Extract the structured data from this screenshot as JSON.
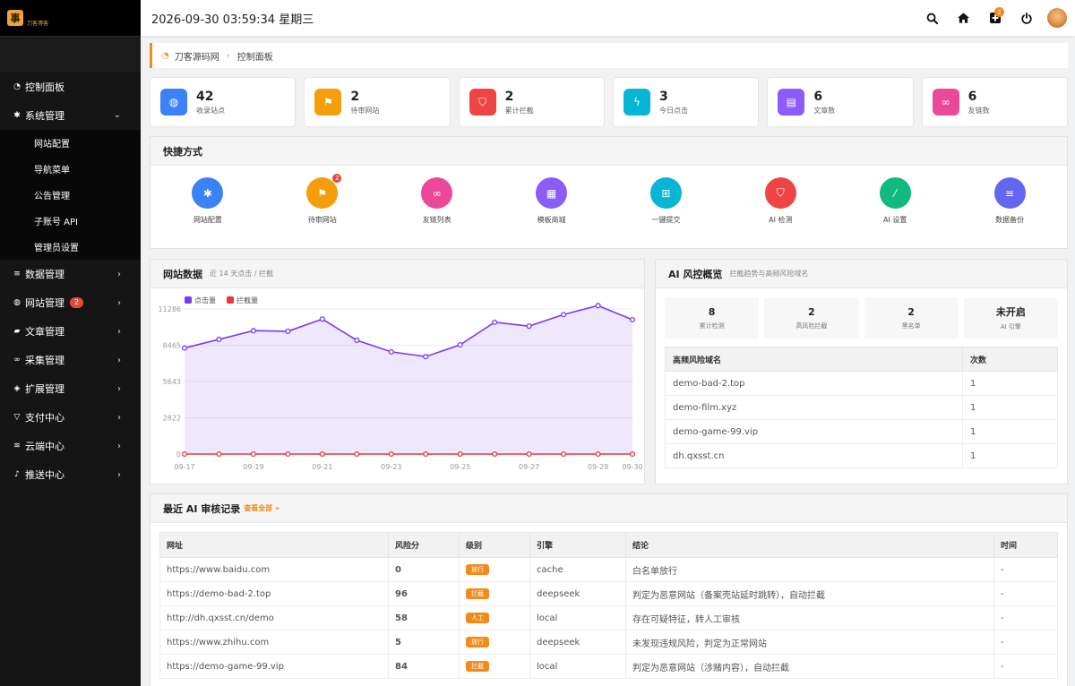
{
  "app": {
    "logo_char": "事",
    "logo_text": "刀客博客"
  },
  "topbar": {
    "datetime": "2026-09-30 03:59:34 星期三",
    "notification_count": "2"
  },
  "sidebar": {
    "items": [
      {
        "label": "控制面板",
        "icon": "dashboard-icon"
      },
      {
        "label": "系统管理",
        "icon": "gear-icon",
        "expanded": true,
        "children": [
          "网站配置",
          "导航菜单",
          "公告管理",
          "子账号 API",
          "管理员设置"
        ]
      },
      {
        "label": "数据管理",
        "icon": "database-icon"
      },
      {
        "label": "网站管理",
        "icon": "globe-icon",
        "badge": "2"
      },
      {
        "label": "文章管理",
        "icon": "book-icon"
      },
      {
        "label": "采集管理",
        "icon": "link-icon"
      },
      {
        "label": "扩展管理",
        "icon": "cube-icon"
      },
      {
        "label": "支付中心",
        "icon": "cart-icon"
      },
      {
        "label": "云端中心",
        "icon": "wifi-icon"
      },
      {
        "label": "推送中心",
        "icon": "bell-icon"
      }
    ]
  },
  "breadcrumb": {
    "site": "刀客源码网",
    "current": "控制面板"
  },
  "stats": [
    {
      "value": "42",
      "label": "收录站点",
      "color": "#3b82f6",
      "icon": "globe-icon"
    },
    {
      "value": "2",
      "label": "待审网站",
      "color": "#f59e0b",
      "icon": "flag-icon"
    },
    {
      "value": "2",
      "label": "累计拦截",
      "color": "#ef4444",
      "icon": "shield-icon"
    },
    {
      "value": "3",
      "label": "今日点击",
      "color": "#06b6d4",
      "icon": "bolt-icon"
    },
    {
      "value": "6",
      "label": "文章数",
      "color": "#8b5cf6",
      "icon": "document-icon"
    },
    {
      "value": "6",
      "label": "友链数",
      "color": "#ec4899",
      "icon": "link-icon"
    }
  ],
  "quick": {
    "title": "快捷方式",
    "items": [
      {
        "label": "网站配置",
        "color": "#3b82f6",
        "icon": "gear-icon"
      },
      {
        "label": "待审网站",
        "color": "#f59e0b",
        "icon": "flag-icon",
        "badge": "2"
      },
      {
        "label": "友链列表",
        "color": "#ec4899",
        "icon": "link-icon"
      },
      {
        "label": "模板商城",
        "color": "#8b5cf6",
        "icon": "grid-icon"
      },
      {
        "label": "一键提交",
        "color": "#06b6d4",
        "icon": "plus-icon"
      },
      {
        "label": "AI 检测",
        "color": "#ef4444",
        "icon": "shield-icon"
      },
      {
        "label": "AI 设置",
        "color": "#10b981",
        "icon": "wand-icon"
      },
      {
        "label": "数据备份",
        "color": "#6366f1",
        "icon": "database-icon"
      }
    ]
  },
  "site_data": {
    "title": "网站数据",
    "subtitle": "近 14 天点击 / 拦截"
  },
  "chart_data": {
    "type": "area",
    "x": [
      "09-17",
      "09-18",
      "09-19",
      "09-20",
      "09-21",
      "09-22",
      "09-23",
      "09-24",
      "09-25",
      "09-26",
      "09-27",
      "09-28",
      "09-29",
      "09-30"
    ],
    "x_tick_labels": [
      "09-17",
      "09-19",
      "09-21",
      "09-23",
      "09-25",
      "09-27",
      "09-29",
      "09-30"
    ],
    "y_ticks": [
      "0",
      "2822",
      "5643",
      "8465",
      "11286"
    ],
    "ylim": [
      0,
      11286
    ],
    "grid": true,
    "legend_position": "top-left",
    "series": [
      {
        "name": "点击量",
        "color": "#7c3aed",
        "values": [
          8250,
          8920,
          9600,
          9550,
          10500,
          8850,
          7950,
          7580,
          8500,
          10250,
          9950,
          10850,
          11550,
          10450
        ]
      },
      {
        "name": "拦截量",
        "color": "#e53935",
        "values": [
          0,
          0,
          0,
          0,
          0,
          0,
          0,
          0,
          0,
          0,
          0,
          0,
          0,
          0
        ]
      }
    ]
  },
  "ai_overview": {
    "title": "AI 风控概览",
    "subtitle": "拦截趋势与高频风险域名",
    "boxes": [
      {
        "value": "8",
        "label": "累计检测"
      },
      {
        "value": "2",
        "label": "高风险拦截"
      },
      {
        "value": "2",
        "label": "黑名单"
      },
      {
        "value": "未开启",
        "label": "AI 引擎"
      }
    ],
    "table_headers": [
      "高频风险域名",
      "次数"
    ],
    "rows": [
      {
        "domain": "demo-bad-2.top",
        "count": "1"
      },
      {
        "domain": "demo-film.xyz",
        "count": "1"
      },
      {
        "domain": "demo-game-99.vip",
        "count": "1"
      },
      {
        "domain": "dh.qxsst.cn",
        "count": "1"
      }
    ]
  },
  "recent": {
    "title": "最近 AI 审核记录",
    "view_all": "查看全部 »",
    "headers": [
      "网址",
      "风险分",
      "级别",
      "引擎",
      "结论",
      "时间"
    ],
    "rows": [
      {
        "url": "https://www.baidu.com",
        "score": "0",
        "level": "放行",
        "engine": "cache",
        "conclusion": "白名单放行",
        "time": "-",
        "high": false
      },
      {
        "url": "https://demo-bad-2.top",
        "score": "96",
        "level": "拦截",
        "engine": "deepseek",
        "conclusion": "判定为恶意网站（备案壳站延时跳转），自动拦截",
        "time": "-",
        "high": true
      },
      {
        "url": "http://dh.qxsst.cn/demo",
        "score": "58",
        "level": "人工",
        "engine": "local",
        "conclusion": "存在可疑特征，转人工审核",
        "time": "-",
        "high": false
      },
      {
        "url": "https://www.zhihu.com",
        "score": "5",
        "level": "放行",
        "engine": "deepseek",
        "conclusion": "未发现违规风险，判定为正常网站",
        "time": "-",
        "high": false
      },
      {
        "url": "https://demo-game-99.vip",
        "score": "84",
        "level": "拦截",
        "engine": "local",
        "conclusion": "判定为恶意网站（涉赌内容），自动拦截",
        "time": "-",
        "high": true
      }
    ]
  }
}
